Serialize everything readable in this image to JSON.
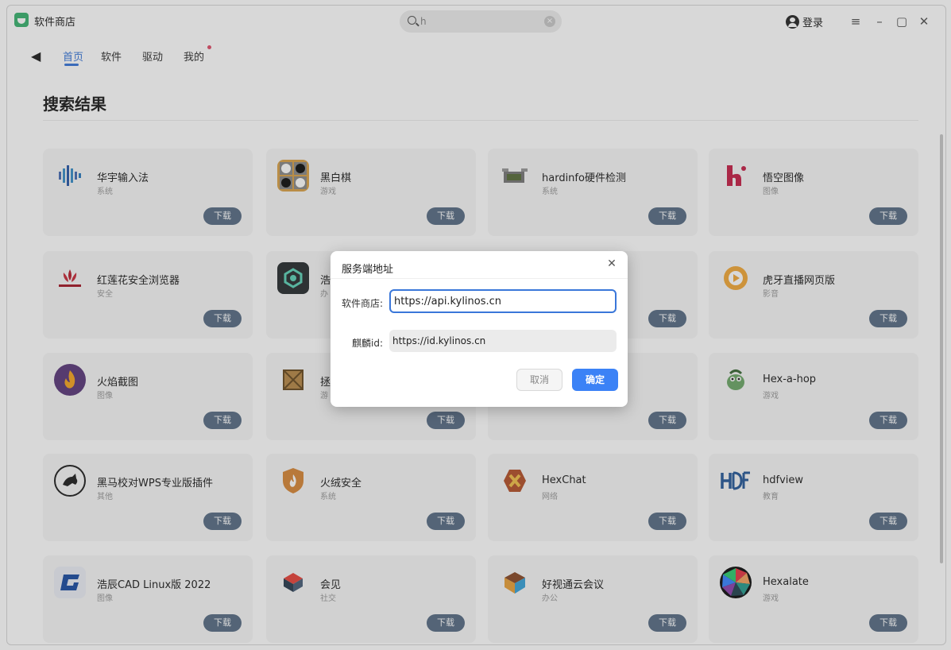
{
  "app": {
    "title": "软件商店"
  },
  "search": {
    "value": "h",
    "placeholder": ""
  },
  "header": {
    "login_label": "登录"
  },
  "nav": {
    "tabs": [
      "首页",
      "软件",
      "驱动",
      "我的"
    ]
  },
  "page": {
    "title": "搜索结果"
  },
  "download_label": "下载",
  "apps": [
    {
      "name": "华宇输入法",
      "category": "系统",
      "icon": "huayu-input-icon"
    },
    {
      "name": "黑白棋",
      "category": "游戏",
      "icon": "reversi-icon"
    },
    {
      "name": "hardinfo硬件检测",
      "category": "系统",
      "icon": "hardinfo-icon"
    },
    {
      "name": "悟空图像",
      "category": "图像",
      "icon": "wukong-image-icon"
    },
    {
      "name": "红莲花安全浏览器",
      "category": "安全",
      "icon": "honglianhua-browser-icon"
    },
    {
      "name": "浩",
      "category": "办",
      "icon": "haochen-app-icon"
    },
    {
      "name": "",
      "category": "",
      "icon": "hidden-app-icon"
    },
    {
      "name": "虎牙直播网页版",
      "category": "影音",
      "icon": "huya-live-icon"
    },
    {
      "name": "火焰截图",
      "category": "图像",
      "icon": "flameshot-icon"
    },
    {
      "name": "拯",
      "category": "游",
      "icon": "box-game-icon"
    },
    {
      "name": "",
      "category": "",
      "icon": "hidden-app-icon"
    },
    {
      "name": "Hex-a-hop",
      "category": "游戏",
      "icon": "hex-a-hop-icon"
    },
    {
      "name": "黑马校对WPS专业版插件",
      "category": "其他",
      "icon": "heima-proofread-icon"
    },
    {
      "name": "火绒安全",
      "category": "系统",
      "icon": "huorong-security-icon"
    },
    {
      "name": "HexChat",
      "category": "网络",
      "icon": "hexchat-icon"
    },
    {
      "name": "hdfview",
      "category": "教育",
      "icon": "hdfview-icon"
    },
    {
      "name": "浩辰CAD Linux版 2022",
      "category": "图像",
      "icon": "haochen-cad-icon"
    },
    {
      "name": "会见",
      "category": "社交",
      "icon": "huijian-icon"
    },
    {
      "name": "好视通云会议",
      "category": "办公",
      "icon": "haoshitong-icon"
    },
    {
      "name": "Hexalate",
      "category": "游戏",
      "icon": "hexalate-icon"
    }
  ],
  "dialog": {
    "title": "服务端地址",
    "store_label": "软件商店:",
    "store_value": "https://api.kylinos.cn",
    "kylin_label": "麒麟id:",
    "kylin_value": "https://id.kylinos.cn",
    "cancel_label": "取消",
    "ok_label": "确定"
  },
  "colors": {
    "accent": "#3a77d9",
    "download_button": "#5a6f86",
    "confirm_button": "#3b82f6",
    "notification_dot": "#e0506b"
  }
}
